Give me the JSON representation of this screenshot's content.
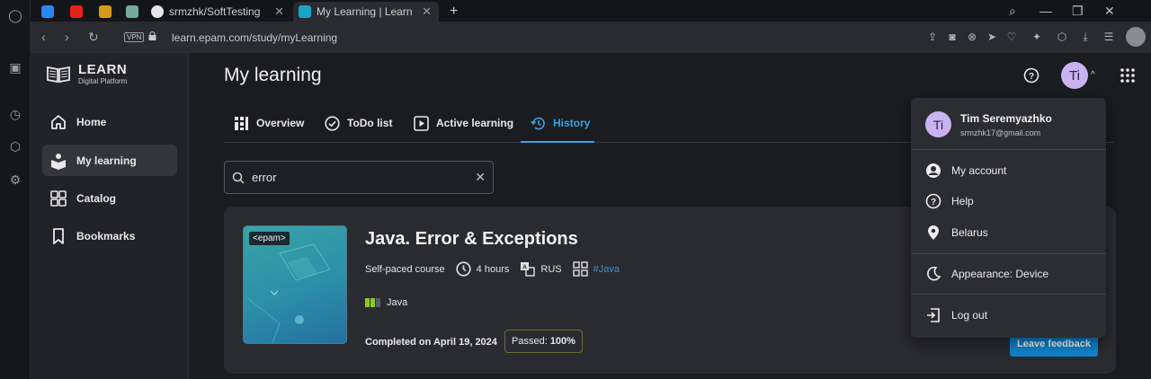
{
  "browser": {
    "tabs": [
      {
        "label": "srmzhk/SoftTesting"
      },
      {
        "label": "My Learning | Learn"
      }
    ],
    "url": "learn.epam.com/study/myLearning",
    "vpn_label": "VPN"
  },
  "sidebar": {
    "logo_title": "LEARN",
    "logo_subtitle": "Digital Platform",
    "items": [
      {
        "label": "Home"
      },
      {
        "label": "My learning"
      },
      {
        "label": "Catalog"
      },
      {
        "label": "Bookmarks"
      }
    ]
  },
  "header": {
    "title": "My learning",
    "avatar_initials": "Ti"
  },
  "page_tabs": [
    {
      "label": "Overview"
    },
    {
      "label": "ToDo list"
    },
    {
      "label": "Active learning"
    },
    {
      "label": "History"
    }
  ],
  "search": {
    "value": "error"
  },
  "course": {
    "badge": "<epam>",
    "title": "Java. Error & Exceptions",
    "type": "Self-paced course",
    "duration": "4 hours",
    "language": "RUS",
    "tag": "#Java",
    "level_label": "Java",
    "completed": "Completed on April 19, 2024",
    "passed_label": "Passed:",
    "passed_value": "100%",
    "feedback_label": "Leave feedback"
  },
  "user_menu": {
    "initials": "Ti",
    "name": "Tim Seremyazhko",
    "email": "srmzhk17@gmail.com",
    "items": [
      {
        "label": "My account"
      },
      {
        "label": "Help"
      },
      {
        "label": "Belarus"
      },
      {
        "label": "Appearance: Device"
      },
      {
        "label": "Log out"
      }
    ]
  },
  "colors": {
    "accent": "#3ba1e6",
    "button": "#0f86d1",
    "avatar": "#c9b3f0"
  }
}
